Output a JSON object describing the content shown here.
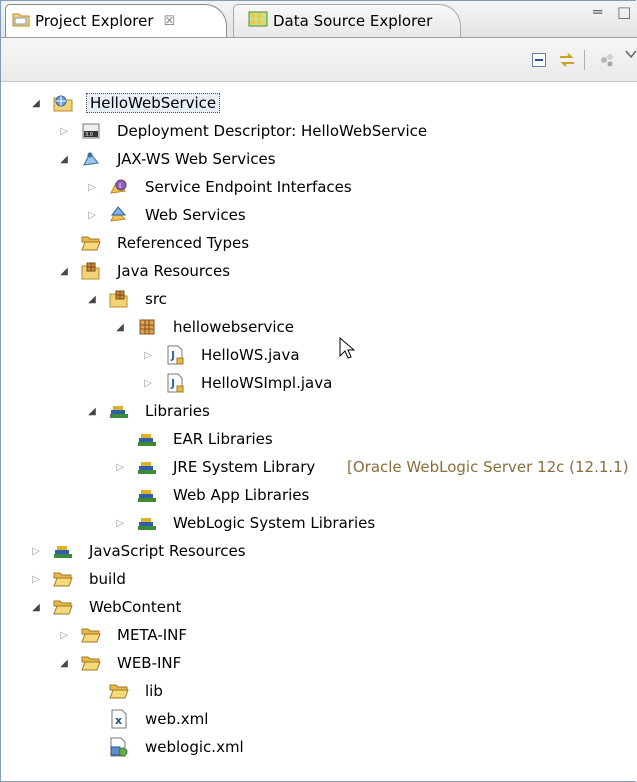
{
  "tabs": [
    {
      "label": "Project Explorer",
      "close": "☒",
      "icon": "project-explorer-icon"
    },
    {
      "label": "Data Source Explorer",
      "icon": "data-source-explorer-icon"
    }
  ],
  "view_controls": {
    "minimize": "═",
    "maximize": "□"
  },
  "toolbar": {
    "buttons": [
      {
        "name": "collapse-all-icon"
      },
      {
        "name": "link-with-editor-icon"
      },
      {
        "name": "filter-icon"
      },
      {
        "name": "view-menu-icon"
      }
    ]
  },
  "tree": {
    "rows": [
      {
        "label": "HelloWebService",
        "icon": "web-project-icon",
        "expanded": true,
        "selected": true
      },
      {
        "label": "Deployment Descriptor: HelloWebService",
        "icon": "deployment-descriptor-icon",
        "expanded": false
      },
      {
        "label": "JAX-WS Web Services",
        "icon": "jaxws-icon",
        "expanded": true
      },
      {
        "label": "Service Endpoint Interfaces",
        "icon": "service-endpoint-icon",
        "expanded": false
      },
      {
        "label": "Web Services",
        "icon": "web-services-icon",
        "expanded": false
      },
      {
        "label": "Referenced Types",
        "icon": "folder-icon"
      },
      {
        "label": "Java Resources",
        "icon": "java-resources-icon",
        "expanded": true
      },
      {
        "label": "src",
        "icon": "source-folder-icon",
        "expanded": true
      },
      {
        "label": "hellowebservice",
        "icon": "package-icon",
        "expanded": true
      },
      {
        "label": "HelloWS.java",
        "icon": "java-file-icon",
        "expanded": false
      },
      {
        "label": "HelloWSImpl.java",
        "icon": "java-file-icon",
        "expanded": false
      },
      {
        "label": "Libraries",
        "icon": "library-icon",
        "expanded": true
      },
      {
        "label": "EAR Libraries",
        "icon": "library-icon"
      },
      {
        "label": "JRE System Library",
        "decoration": "[Oracle WebLogic Server 12c (12.1.1)",
        "icon": "library-icon",
        "expanded": false
      },
      {
        "label": "Web App Libraries",
        "icon": "library-icon"
      },
      {
        "label": "WebLogic System Libraries",
        "icon": "library-icon",
        "expanded": false
      },
      {
        "label": "JavaScript Resources",
        "icon": "library-icon",
        "expanded": false
      },
      {
        "label": "build",
        "icon": "folder-icon",
        "expanded": false
      },
      {
        "label": "WebContent",
        "icon": "folder-icon",
        "expanded": true
      },
      {
        "label": "META-INF",
        "icon": "folder-icon",
        "expanded": false
      },
      {
        "label": "WEB-INF",
        "icon": "folder-icon",
        "expanded": true
      },
      {
        "label": "lib",
        "icon": "folder-icon"
      },
      {
        "label": "web.xml",
        "icon": "xml-file-icon"
      },
      {
        "label": "weblogic.xml",
        "icon": "weblogic-xml-icon"
      }
    ]
  },
  "colors": {
    "selection": "#e8eef7",
    "decoration": "#8a6d3b",
    "border": "#7f9db9"
  }
}
